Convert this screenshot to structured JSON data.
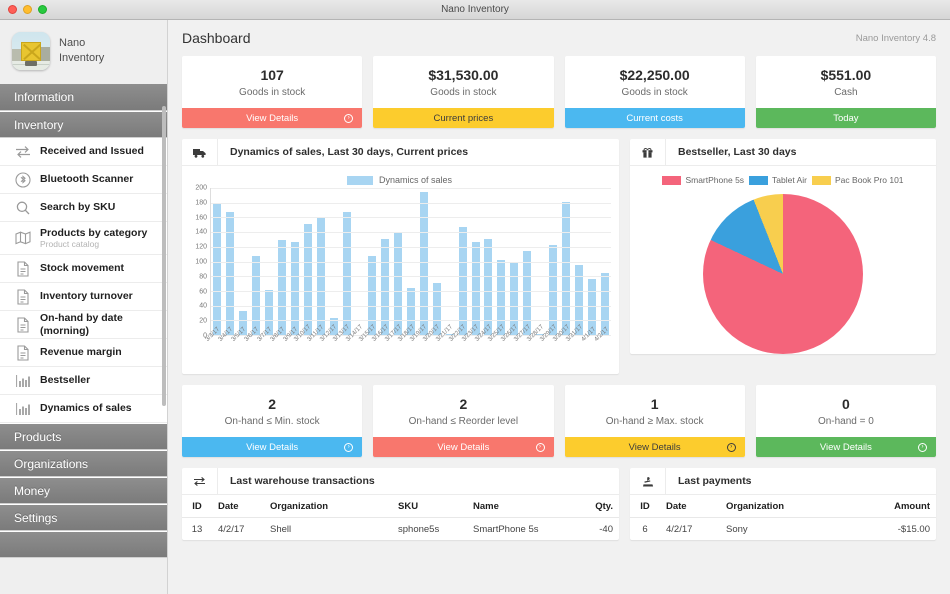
{
  "window": {
    "title": "Nano Inventory"
  },
  "sidebar": {
    "brand_line1": "Nano",
    "brand_line2": "Inventory",
    "groups": {
      "information": "Information",
      "inventory": "Inventory",
      "products": "Products",
      "organizations": "Organizations",
      "money": "Money",
      "settings": "Settings"
    },
    "items": [
      {
        "label": "Received and Issued",
        "sub": "",
        "icon": "arrows-exchange-icon"
      },
      {
        "label": "Bluetooth Scanner",
        "sub": "",
        "icon": "bluetooth-icon"
      },
      {
        "label": "Search by SKU",
        "sub": "",
        "icon": "search-icon"
      },
      {
        "label": "Products by category",
        "sub": "Product catalog",
        "icon": "map-icon"
      },
      {
        "label": "Stock movement",
        "sub": "",
        "icon": "document-icon"
      },
      {
        "label": "Inventory turnover",
        "sub": "",
        "icon": "document-icon"
      },
      {
        "label": "On-hand by date (morning)",
        "sub": "",
        "icon": "document-icon"
      },
      {
        "label": "Revenue margin",
        "sub": "",
        "icon": "document-icon"
      },
      {
        "label": "Bestseller",
        "sub": "",
        "icon": "bar-chart-icon"
      },
      {
        "label": "Dynamics of sales",
        "sub": "",
        "icon": "bar-chart-icon"
      }
    ]
  },
  "header": {
    "title": "Dashboard",
    "version": "Nano Inventory 4.8"
  },
  "colors": {
    "coral": "#f8776d",
    "yellow": "#fccc2d",
    "blue": "#4bb8f0",
    "green": "#5cb85c",
    "bar": "#a8d5f2",
    "pie_red": "#f4647b",
    "pie_blue": "#3aa0dd",
    "pie_yellow": "#f8ce4e"
  },
  "kpi_top": [
    {
      "value": "107",
      "caption": "Goods in stock",
      "button": "View Details",
      "color": "#f8776d",
      "arrow": "●",
      "has_arrow": true,
      "dark": false
    },
    {
      "value": "$31,530.00",
      "caption": "Goods in stock",
      "button": "Current prices",
      "color": "#fccc2d",
      "arrow": "",
      "has_arrow": false,
      "dark": true
    },
    {
      "value": "$22,250.00",
      "caption": "Goods in stock",
      "button": "Current costs",
      "color": "#4bb8f0",
      "arrow": "",
      "has_arrow": false,
      "dark": false
    },
    {
      "value": "$551.00",
      "caption": "Cash",
      "button": "Today",
      "color": "#5cb85c",
      "arrow": "",
      "has_arrow": false,
      "dark": false
    }
  ],
  "kpi_mid": [
    {
      "value": "2",
      "caption": "On-hand ≤ Min. stock",
      "button": "View Details",
      "color": "#4bb8f0",
      "dark": false
    },
    {
      "value": "2",
      "caption": "On-hand ≤ Reorder level",
      "button": "View Details",
      "color": "#f8776d",
      "dark": false
    },
    {
      "value": "1",
      "caption": "On-hand ≥ Max. stock",
      "button": "View Details",
      "color": "#fccc2d",
      "dark": true
    },
    {
      "value": "0",
      "caption": "On-hand = 0",
      "button": "View Details",
      "color": "#5cb85c",
      "dark": false
    }
  ],
  "panels": {
    "sales": {
      "title": "Dynamics of sales, Last 30 days, Current prices",
      "icon": "truck-icon"
    },
    "bestseller": {
      "title": "Bestseller, Last 30 days",
      "icon": "gift-icon"
    },
    "transactions": {
      "title": "Last warehouse transactions",
      "icon": "exchange-icon"
    },
    "payments": {
      "title": "Last payments",
      "icon": "money-icon"
    }
  },
  "chart_data": [
    {
      "type": "bar",
      "title": "Dynamics of sales, Last 30 days, Current prices",
      "legend": [
        "Dynamics of sales"
      ],
      "legend_position": "top-center",
      "xlabel": "",
      "ylabel": "",
      "ylim": [
        0,
        200
      ],
      "yticks": [
        0,
        20,
        40,
        60,
        80,
        100,
        120,
        140,
        160,
        180,
        200
      ],
      "grid": true,
      "color": "#a8d5f2",
      "categories": [
        "3/3/17",
        "3/4/17",
        "3/5/17",
        "3/6/17",
        "3/7/17",
        "3/8/17",
        "3/9/17",
        "3/10/17",
        "3/11/17",
        "3/12/17",
        "3/13/17",
        "3/14/17",
        "3/15/17",
        "3/16/17",
        "3/17/17",
        "3/18/17",
        "3/19/17",
        "3/20/17",
        "3/21/17",
        "3/22/17",
        "3/23/17",
        "3/24/17",
        "3/25/17",
        "3/26/17",
        "3/27/17",
        "3/28/17",
        "3/29/17",
        "3/30/17",
        "3/31/17",
        "4/1/17",
        "4/2/17"
      ],
      "values": [
        179,
        167,
        33,
        108,
        61,
        129,
        126,
        151,
        161,
        23,
        167,
        0.5,
        107,
        131,
        140,
        64,
        195,
        71,
        2,
        147,
        127,
        131,
        102,
        98,
        114,
        1,
        122,
        181,
        95,
        76,
        85
      ]
    },
    {
      "type": "pie",
      "title": "Bestseller, Last 30 days",
      "legend_position": "top-center",
      "labels": [
        "SmartPhone 5s",
        "Tablet Air",
        "Pac Book Pro 101"
      ],
      "values": [
        82,
        12,
        6
      ],
      "colors": [
        "#f4647b",
        "#3aa0dd",
        "#f8ce4e"
      ]
    }
  ],
  "tables": {
    "transactions": {
      "columns": [
        "ID",
        "Date",
        "Organization",
        "SKU",
        "Name",
        "Qty."
      ],
      "rows": [
        [
          "13",
          "4/2/17",
          "Shell",
          "sphone5s",
          "SmartPhone 5s",
          "-40"
        ]
      ]
    },
    "payments": {
      "columns": [
        "ID",
        "Date",
        "Organization",
        "Amount"
      ],
      "rows": [
        [
          "6",
          "4/2/17",
          "Sony",
          "-$15.00"
        ]
      ]
    }
  }
}
